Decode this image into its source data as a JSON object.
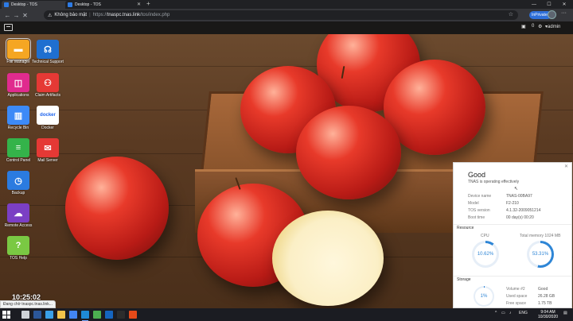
{
  "browser": {
    "tabs": [
      {
        "title": "Desktop - TOS",
        "active": true
      },
      {
        "title": "Desktop - TOS",
        "active": false
      }
    ],
    "new_tab_symbol": "+",
    "window_controls": [
      "—",
      "☐",
      "✕"
    ],
    "nav": {
      "back": "←",
      "forward": "→",
      "reload": "✕"
    },
    "security_label": "Không bảo mật",
    "url_prefix": "https://",
    "url_host": "tnaspc.tnas.link",
    "url_path": "/tos/index.php",
    "inprivate_label": "InPrivate",
    "more_symbol": "···",
    "status_text": "Đang chờ tnaspc.tnas.link..."
  },
  "tos": {
    "header_right": {
      "message_count": "0",
      "user": "admin"
    },
    "desktop_icons": [
      {
        "label": "File Manager",
        "icon": "folder-icon",
        "color": "#f5a623",
        "glyph": "▬"
      },
      {
        "label": "Technical Support",
        "icon": "headset-icon",
        "color": "#1f6fd0",
        "glyph": "☊"
      },
      {
        "label": "Applications",
        "icon": "shopping-bag-icon",
        "color": "#e02b8e",
        "glyph": "◫"
      },
      {
        "label": "Claim Artifacts",
        "icon": "claim-icon",
        "color": "#e53935",
        "glyph": "⚇"
      },
      {
        "label": "Recycle Bin",
        "icon": "trash-icon",
        "color": "#3d8af7",
        "glyph": "🗑"
      },
      {
        "label": "Docker",
        "icon": "docker-icon",
        "color": "#ffffff",
        "glyph": "docker"
      },
      {
        "label": "Control Panel",
        "icon": "sliders-icon",
        "color": "#34b34a",
        "glyph": "≡"
      },
      {
        "label": "Mail Server",
        "icon": "mail-icon",
        "color": "#e53935",
        "glyph": "✉"
      },
      {
        "label": "Backup",
        "icon": "clock-icon",
        "color": "#2b7be0",
        "glyph": "◷"
      },
      {
        "label": "Remote Access",
        "icon": "cloud-icon",
        "color": "#7b3fc4",
        "glyph": "☁"
      },
      {
        "label": "TOS Help",
        "icon": "help-icon",
        "color": "#7ac943",
        "glyph": "?"
      }
    ],
    "clock": "10:25:02",
    "status_panel": {
      "status_title": "Good",
      "status_subtitle": "TNAS is operating effectively",
      "device_info": [
        {
          "key": "Device name",
          "value": "TNAS-00BA97"
        },
        {
          "key": "Model",
          "value": "F2-210"
        },
        {
          "key": "TOS version",
          "value": "4.1.32-2009051214"
        },
        {
          "key": "Boot time",
          "value": "00 day(s) 00:20"
        }
      ],
      "resource_label": "Resource",
      "cpu_label": "CPU",
      "cpu_percent": "10.62%",
      "cpu_fraction": 0.1062,
      "memory_label": "Total memory 1024 MB",
      "memory_percent": "53.31%",
      "memory_fraction": 0.5331,
      "storage_label": "Storage",
      "storage_percent": "1%",
      "storage_fraction": 0.01,
      "storage_info": [
        {
          "key": "Volume #2",
          "value": "Good"
        },
        {
          "key": "Used space",
          "value": "26.28 GB"
        },
        {
          "key": "Free space",
          "value": "1.75 TB"
        }
      ],
      "accent_color": "#2f86d6"
    }
  },
  "taskbar": {
    "pinned": [
      {
        "name": "task-view-icon",
        "color": "#cfd3d8"
      },
      {
        "name": "word-icon",
        "color": "#2b579a"
      },
      {
        "name": "edge-icon",
        "color": "#3aa0e8"
      },
      {
        "name": "explorer-icon",
        "color": "#f2c34a"
      },
      {
        "name": "browser-icon",
        "color": "#4285f4"
      },
      {
        "name": "edge-active-icon",
        "color": "#1e8ad6"
      },
      {
        "name": "app-green-icon",
        "color": "#4caf50"
      },
      {
        "name": "app-blue-icon",
        "color": "#1565c0"
      },
      {
        "name": "app-dark-icon",
        "color": "#2c2c2c"
      },
      {
        "name": "app-red-icon",
        "color": "#e64a19"
      }
    ],
    "language": "ENG",
    "time": "9:04 AM",
    "date": "10/30/2020"
  }
}
